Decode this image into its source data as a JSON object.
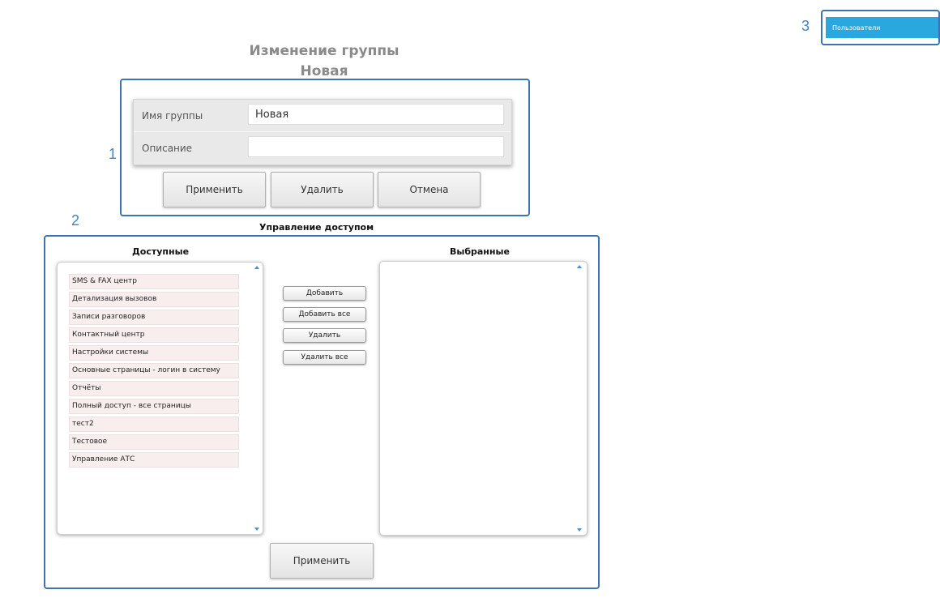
{
  "callouts": [
    "1",
    "2",
    "3"
  ],
  "header": {
    "title": "Изменение группы",
    "subtitle": "Новая"
  },
  "form": {
    "name_label": "Имя группы",
    "name_value": "Новая",
    "description_label": "Описание",
    "description_value": ""
  },
  "form_buttons": {
    "apply": "Применить",
    "delete": "Удалить",
    "cancel": "Отмена"
  },
  "access": {
    "title": "Управление доступом",
    "available_title": "Доступные",
    "selected_title": "Выбранные",
    "available_items": [
      "SMS & FAX центр",
      "Детализация вызовов",
      "Записи разговоров",
      "Контактный центр",
      "Настройки системы",
      "Основные страницы - логин в систему",
      "Отчёты",
      "Полный доступ - все страницы",
      "тест2",
      "Тестовое",
      "Управление АТС"
    ],
    "selected_items": [],
    "buttons": {
      "add": "Добавить",
      "add_all": "Добавить все",
      "remove": "Удалить",
      "remove_all": "Удалить все"
    },
    "apply": "Применить"
  },
  "nav": {
    "users_label": "Пользователи"
  },
  "colors": {
    "frame": "#3b73b3",
    "callout": "#3f86c5",
    "users_button": "#29a8e0",
    "list_item_bg": "#f8eeee"
  }
}
